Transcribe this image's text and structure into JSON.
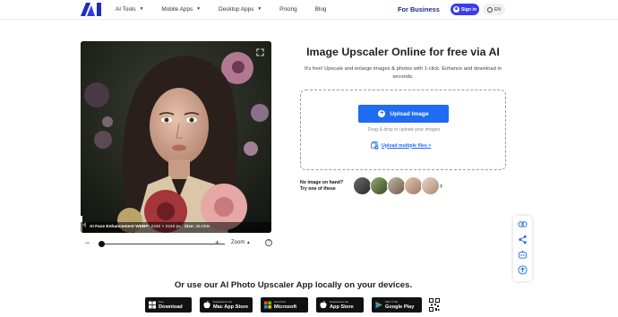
{
  "header": {
    "nav": [
      {
        "label": "AI Tools",
        "dropdown": true
      },
      {
        "label": "Mobile Apps",
        "dropdown": true
      },
      {
        "label": "Desktop Apps",
        "dropdown": true
      },
      {
        "label": "Pricing",
        "dropdown": false
      },
      {
        "label": "Blog",
        "dropdown": false
      }
    ],
    "for_business": "For Business",
    "sign_in": "Sign in",
    "language": "EN"
  },
  "preview": {
    "caption_tool": "AI Face Enhancement",
    "caption_format": "WEBP:",
    "caption_dims": "2240 × 2240 px",
    "caption_size_label": "Size:",
    "caption_size": "45.0KB"
  },
  "zoom": {
    "label": "Zoom",
    "level": 0.0
  },
  "main": {
    "title": "Image Upscaler Online for free via AI",
    "subtitle": "It's free! Upscale and enlarge images & photos with 1-click. Enhance and download in seconds.",
    "upload_button": "Upload Image",
    "drag_text": "Drag & drop to upload your images",
    "multiple_link": "Upload multiple files >",
    "samples_line1": "No image on hand?",
    "samples_line2": "Try one of these"
  },
  "bottom": {
    "title": "Or use our AI Photo Upscaler App locally on your devices.",
    "stores": [
      {
        "small": "Free",
        "big": "Download",
        "icon": "windows-icon"
      },
      {
        "small": "Download on the",
        "big": "Mac App Store",
        "icon": "apple-icon"
      },
      {
        "small": "Get it from",
        "big": "Microsoft",
        "icon": "windows-icon"
      },
      {
        "small": "Download on the",
        "big": "App Store",
        "icon": "apple-icon"
      },
      {
        "small": "GET IT ON",
        "big": "Google Play",
        "icon": "play-icon"
      }
    ]
  },
  "colors": {
    "accent": "#1f6bf2",
    "brand_dark": "#1b2a8a",
    "sign_in": "#3b3bf0"
  }
}
